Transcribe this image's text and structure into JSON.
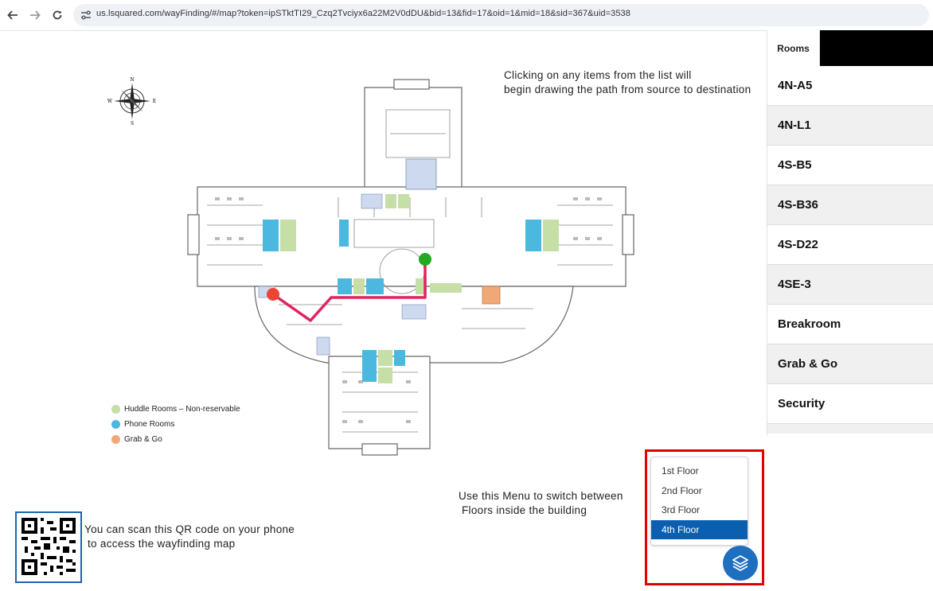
{
  "browser": {
    "url": "us.lsquared.com/wayFinding/#/map?token=ipSTktTI29_Czq2Tvciyx6a22M2V0dDU&bid=13&fid=17&oid=1&mid=18&sid=367&uid=3538"
  },
  "map": {
    "compass": {
      "n": "N",
      "s": "S",
      "e": "E",
      "w": "W"
    },
    "instruction_list": [
      "Clicking on any items from the list will",
      "begin drawing the path from source to destination"
    ],
    "instruction_menu": [
      "Use this Menu to switch between",
      "Floors inside the building"
    ],
    "instruction_qr": [
      "You can scan this QR code on your phone",
      "to access the wayfinding map"
    ],
    "legend": [
      {
        "label": "Huddle Rooms – Non-reservable",
        "color": "#c6dfa6"
      },
      {
        "label": "Phone Rooms",
        "color": "#4bb8e0"
      },
      {
        "label": "Grab & Go",
        "color": "#f0a877"
      }
    ]
  },
  "rooms": {
    "tab_label": "Rooms",
    "items": [
      "4N-A5",
      "4N-L1",
      "4S-B5",
      "4S-B36",
      "4S-D22",
      "4SE-3",
      "Breakroom",
      "Grab & Go",
      "Security"
    ]
  },
  "floors": {
    "options": [
      "1st Floor",
      "2nd Floor",
      "3rd Floor",
      "4th Floor"
    ],
    "selected": "4th Floor"
  },
  "colors": {
    "accent": "#0b5fb0",
    "path": "#e0245e",
    "highlight_frame": "#e00000",
    "phone_room": "#4bb8e0",
    "huddle_room": "#c6dfa6",
    "grab_go": "#f0a877",
    "source_marker": "#ee4433",
    "dest_marker": "#22aa22"
  }
}
